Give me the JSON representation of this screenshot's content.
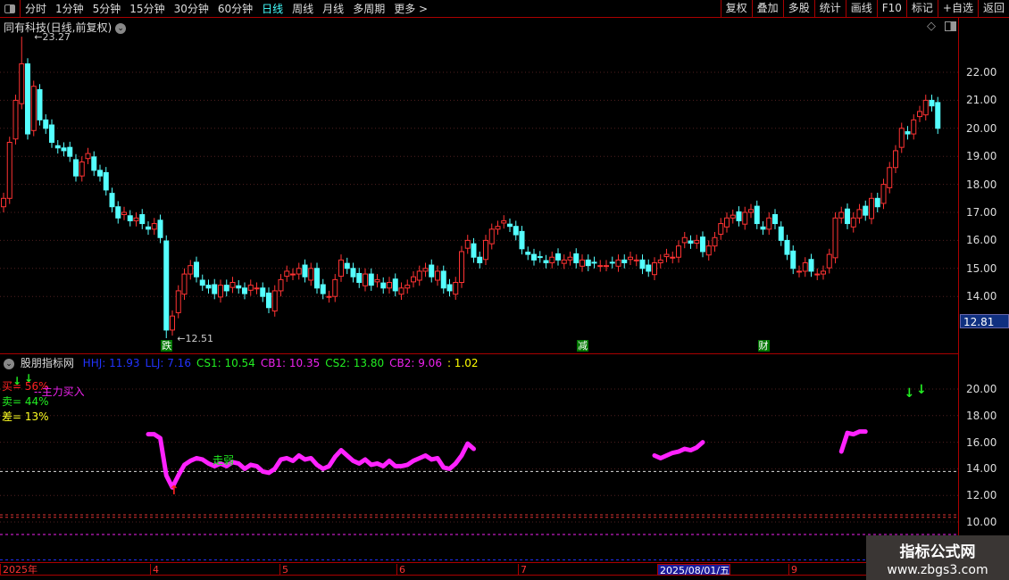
{
  "toolbar": {
    "periods": [
      "分时",
      "1分钟",
      "5分钟",
      "15分钟",
      "30分钟",
      "60分钟",
      "日线",
      "周线",
      "月线",
      "多周期",
      "更多 >"
    ],
    "active": "日线",
    "right_buttons": [
      "复权",
      "叠加",
      "多股",
      "统计",
      "画线",
      "F10",
      "标记",
      "+自选",
      "返回"
    ]
  },
  "title": "同有科技(日线,前复权)",
  "price_axis": [
    "22.00",
    "21.00",
    "20.00",
    "19.00",
    "18.00",
    "17.00",
    "16.00",
    "15.00",
    "14.00"
  ],
  "current_price": "12.81",
  "high_label": "23.27",
  "low_label": "12.51",
  "markers": [
    {
      "text": "跌",
      "idx": 27
    },
    {
      "text": "减",
      "idx": 96
    },
    {
      "text": "财",
      "idx": 126
    }
  ],
  "indicator": {
    "name": "股朋指标网",
    "fields": [
      {
        "t": "HHJ: 11.93",
        "c": "#2233ff"
      },
      {
        "t": "LLJ: 7.16",
        "c": "#2233ff"
      },
      {
        "t": "CS1: 10.54",
        "c": "#22ee22"
      },
      {
        "t": "CB1: 10.35",
        "c": "#ee22ee"
      },
      {
        "t": "CS2: 13.80",
        "c": "#22ee22"
      },
      {
        "t": "CB2: 9.06",
        "c": "#ee22ee"
      },
      {
        "t": ": 1.02",
        "c": "#ffff00"
      }
    ],
    "buy": "买= 56%",
    "sell": "卖= 44%",
    "diff": "差= 13%",
    "main_buy": "--主力买入",
    "weak": "走弱",
    "axis": [
      "20.00",
      "18.00",
      "16.00",
      "14.00",
      "12.00",
      "10.00"
    ]
  },
  "colors": {
    "up": "#ff3333",
    "down": "#55ffff",
    "line": "#ff22ff"
  },
  "dates": [
    "2025年",
    "4",
    "5",
    "6",
    "7",
    "2025/08/01/五",
    "9"
  ],
  "watermark": {
    "line1": "指标公式网",
    "line2": "www.zbgs3.com"
  },
  "chart_data": {
    "type": "candlestick",
    "closes": [
      17.5,
      19.5,
      21,
      22.3,
      19.8,
      21.5,
      20.3,
      20.0,
      19.5,
      19.3,
      19.2,
      19.0,
      18.3,
      18.8,
      19.1,
      18.5,
      18.3,
      17.8,
      17.2,
      16.8,
      17.0,
      16.7,
      16.8,
      16.6,
      16.4,
      16.6,
      16.1,
      12.8,
      13.3,
      14.2,
      14.8,
      15.1,
      14.7,
      14.4,
      14.3,
      14.1,
      14.4,
      14.2,
      14.5,
      14.3,
      14.1,
      14.4,
      14.3,
      14.0,
      13.6,
      14.2,
      14.6,
      14.9,
      14.8,
      15.0,
      14.7,
      15.0,
      14.3,
      14.1,
      14.0,
      14.6,
      15.3,
      15.0,
      14.7,
      14.5,
      14.8,
      14.4,
      14.6,
      14.3,
      14.5,
      14.2,
      14.3,
      14.4,
      14.7,
      14.9,
      15.0,
      14.7,
      14.9,
      14.3,
      14.2,
      14.5,
      15.6,
      16.0,
      15.4,
      15.2,
      16.0,
      16.4,
      16.5,
      16.7,
      16.5,
      16.2,
      15.7,
      15.5,
      15.3,
      15.4,
      15.2,
      15.4,
      15.3,
      15.3,
      15.4,
      15.2,
      15.3,
      15.1,
      15.2,
      15.1,
      15.1,
      15.2,
      15.3,
      15.2,
      15.4,
      15.3,
      15.0,
      14.9,
      15.2,
      15.3,
      15.5,
      15.4,
      15.8,
      16.1,
      15.9,
      16.0,
      15.6,
      15.8,
      16.1,
      16.6,
      16.8,
      16.9,
      16.7,
      17.0,
      17.1,
      16.6,
      16.4,
      16.8,
      16.6,
      16.0,
      15.5,
      15.0,
      14.9,
      15.2,
      14.9,
      14.8,
      14.9,
      15.5,
      16.8,
      17.0,
      16.6,
      16.8,
      17.1,
      16.9,
      17.5,
      17.2,
      18.0,
      18.6,
      19.2,
      20.0,
      19.8,
      20.3,
      20.6,
      21.0,
      20.8,
      20.0
    ],
    "high_idx": 3,
    "low_idx": 27,
    "ylim": [
      11.8,
      23.5
    ],
    "indicator_segments": [
      {
        "start": 24,
        "values": [
          16.6,
          16.6,
          16.3,
          13.5,
          12.6,
          13.5,
          14.3,
          14.6,
          14.8,
          14.7,
          14.4,
          14.2,
          14.4,
          14.2,
          14.5,
          14.4,
          14.0,
          14.3,
          14.2,
          13.8,
          13.7,
          14.0,
          14.7,
          14.8,
          14.6,
          15.0,
          14.7,
          14.8,
          14.3,
          14.0,
          14.2,
          14.9,
          15.4,
          15.0,
          14.6,
          14.4,
          14.7,
          14.3,
          14.4,
          14.2,
          14.6,
          14.2,
          14.2,
          14.3,
          14.6,
          14.8,
          15.0,
          14.7,
          14.8,
          14.1,
          14.0,
          14.4,
          15.0,
          15.9,
          15.5
        ]
      },
      {
        "start": 108,
        "values": [
          15.0,
          14.8,
          15.0,
          15.2,
          15.3,
          15.5,
          15.4,
          15.6,
          16.0
        ]
      },
      {
        "start": 139,
        "values": [
          15.3,
          16.7,
          16.6,
          16.8,
          16.8
        ]
      }
    ],
    "indicator_levels": [
      {
        "v": 13.8,
        "c": "#dddddd"
      },
      {
        "v": 10.54,
        "c": "#dd3333"
      },
      {
        "v": 10.35,
        "c": "#dd3333"
      },
      {
        "v": 9.06,
        "c": "#ee22ee"
      },
      {
        "v": 7.16,
        "c": "#2233ff"
      }
    ],
    "buy_arrows_idx": [
      150,
      152
    ],
    "sell_arrow_idx": 28
  }
}
